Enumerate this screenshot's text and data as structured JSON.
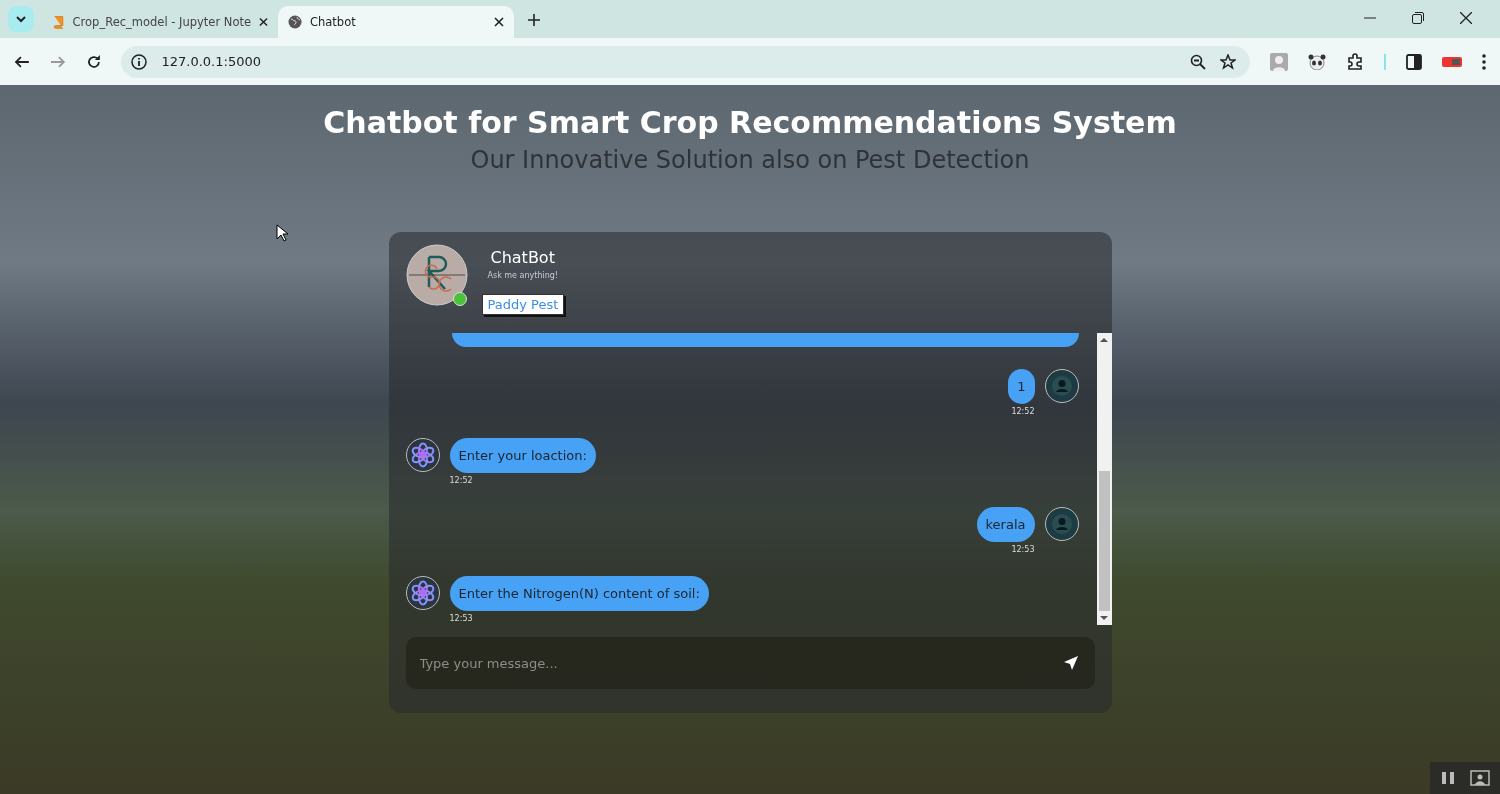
{
  "browser": {
    "tabs": [
      {
        "title": "Crop_Rec_model - Jupyter Note",
        "kind": "notebook",
        "selected": false
      },
      {
        "title": "Chatbot",
        "kind": "web",
        "selected": true
      }
    ],
    "address": "127.0.0.1:5000"
  },
  "page": {
    "title": "Chatbot for Smart Crop Recommendations System",
    "subtitle": "Our Innovative Solution also on Pest Detection"
  },
  "chat": {
    "name": "ChatBot",
    "tagline": "Ask me anything!",
    "online": true,
    "tooltip": "Paddy Pest",
    "messages": [
      {
        "kind": "user",
        "text": "1",
        "time": "12:52"
      },
      {
        "kind": "bot",
        "text": "Enter your loaction:",
        "time": "12:52"
      },
      {
        "kind": "user",
        "text": "kerala",
        "time": "12:53"
      },
      {
        "kind": "bot",
        "text": "Enter the Nitrogen(N) content of soil:",
        "time": "12:53"
      }
    ],
    "input": {
      "placeholder": "Type your message..."
    }
  }
}
